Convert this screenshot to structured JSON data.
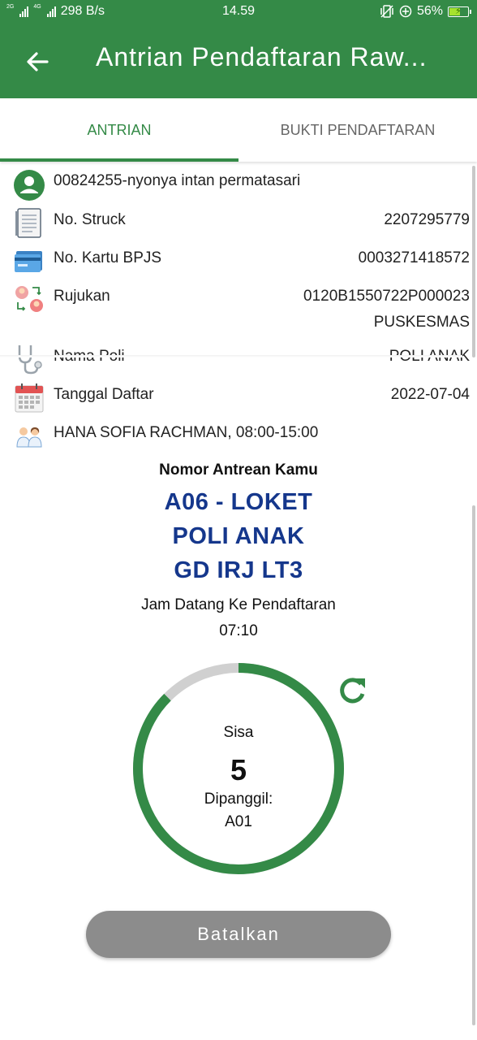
{
  "statusbar": {
    "net_left": "2G",
    "net_right": "4G",
    "speed": "298 B/s",
    "time": "14.59",
    "battery": "56%"
  },
  "appbar": {
    "title": "Antrian Pendaftaran Raw..."
  },
  "tabs": {
    "antrian": "ANTRIAN",
    "bukti": "BUKTI PENDAFTARAN",
    "active": "ANTRIAN"
  },
  "info": {
    "patient": "00824255-nyonya intan permatasari",
    "struck_label": "No. Struck",
    "struck_value": "2207295779",
    "bpjs_label": "No. Kartu BPJS",
    "bpjs_value": "0003271418572",
    "rujukan_label": "Rujukan",
    "rujukan_value": "0120B1550722P000023",
    "rujukan_source": "PUSKESMAS",
    "poli_label": "Nama Poli",
    "poli_value": "POLI ANAK",
    "tanggal_label": "Tanggal Daftar",
    "tanggal_value": "2022-07-04",
    "doctor": "HANA SOFIA RACHMAN, 08:00-15:00"
  },
  "queue": {
    "heading": "Nomor Antrean Kamu",
    "line1": "A06 - LOKET",
    "line2": "POLI ANAK",
    "line3": "GD IRJ LT3",
    "arrival_label": "Jam Datang Ke Pendaftaran",
    "arrival_time": "07:10",
    "sisa_label": "Sisa",
    "sisa_value": "5",
    "called_label": "Dipanggil:",
    "called_value": "A01",
    "progress_fraction": 0.875
  },
  "actions": {
    "cancel": "Batalkan"
  },
  "icons": {
    "back": "arrow-left-icon",
    "patient": "user-circle-icon",
    "struck": "receipt-icon",
    "bpjs": "card-icon",
    "rujukan": "referral-icon",
    "poli": "stethoscope-icon",
    "tanggal": "calendar-icon",
    "doctor": "doctors-icon",
    "refresh": "refresh-icon"
  },
  "colors": {
    "primary": "#348a47",
    "queue_text": "#15378c",
    "ring_track": "#d0d0d0",
    "button": "#8c8c8c"
  }
}
